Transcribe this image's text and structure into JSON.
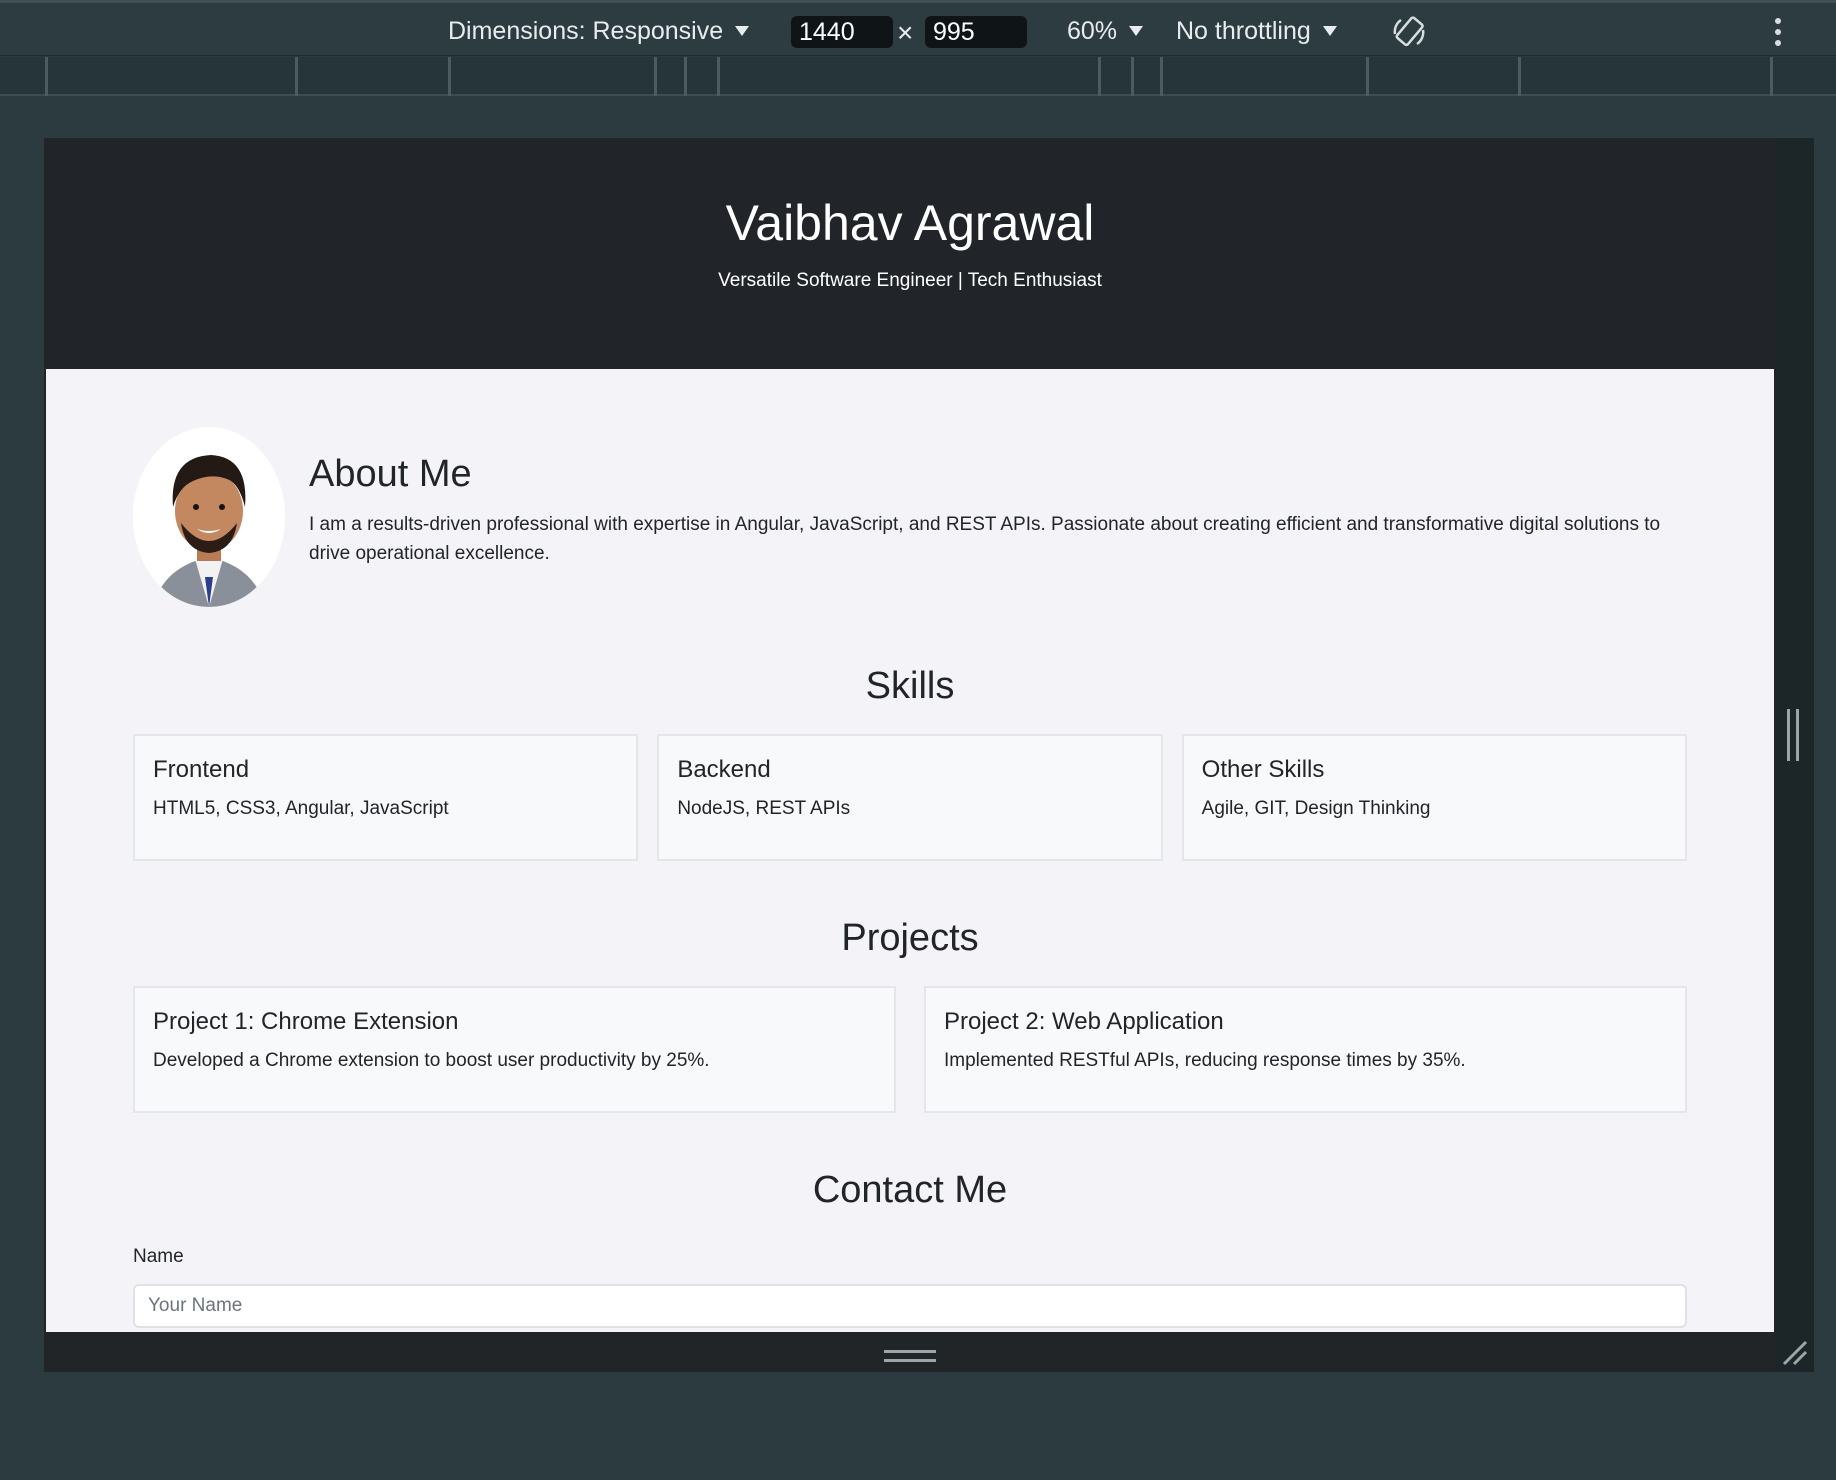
{
  "devtools": {
    "dimensions_label": "Dimensions: Responsive",
    "width": "1440",
    "height": "995",
    "times": "×",
    "zoom": "60%",
    "throttling": "No throttling"
  },
  "header": {
    "name": "Vaibhav Agrawal",
    "tagline": "Versatile Software Engineer | Tech Enthusiast"
  },
  "about": {
    "title": "About Me",
    "text": "I am a results-driven professional with expertise in Angular, JavaScript, and REST APIs. Passionate about creating efficient and transformative digital solutions to drive operational excellence."
  },
  "skills": {
    "title": "Skills",
    "items": [
      {
        "title": "Frontend",
        "desc": "HTML5, CSS3, Angular, JavaScript"
      },
      {
        "title": "Backend",
        "desc": "NodeJS, REST APIs"
      },
      {
        "title": "Other Skills",
        "desc": "Agile, GIT, Design Thinking"
      }
    ]
  },
  "projects": {
    "title": "Projects",
    "items": [
      {
        "title": "Project 1: Chrome Extension",
        "desc": "Developed a Chrome extension to boost user productivity by 25%."
      },
      {
        "title": "Project 2: Web Application",
        "desc": "Implemented RESTful APIs, reducing response times by 35%."
      }
    ]
  },
  "contact": {
    "title": "Contact Me",
    "name_label": "Name",
    "name_placeholder": "Your Name"
  }
}
